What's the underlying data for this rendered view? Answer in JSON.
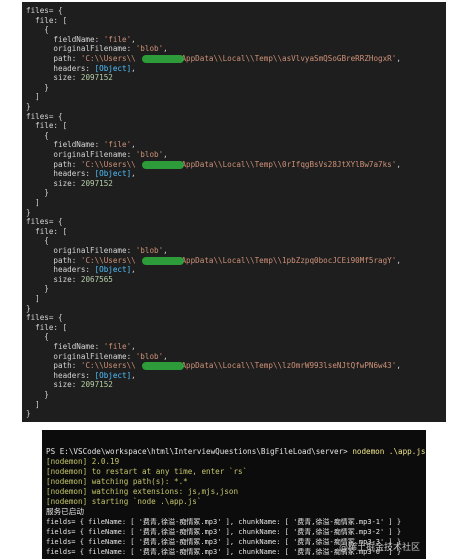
{
  "top_terminal": {
    "lines": [
      {
        "t": "files= {",
        "c": "key"
      },
      {
        "t": "  file: [",
        "c": "key"
      },
      {
        "t": "    {",
        "c": "key"
      },
      {
        "t": "      fieldName: ",
        "c": "key",
        "v": "'file'",
        "vc": "str",
        "s": ","
      },
      {
        "t": "      originalFilename: ",
        "c": "key",
        "v": "'blob'",
        "vc": "str",
        "s": ","
      },
      {
        "t": "      path: ",
        "c": "key",
        "v": "'C:\\\\Users\\\\          AppData\\\\Local\\\\Temp\\\\asVlvyaSmQSoGBreRRZHogxR'",
        "vc": "str",
        "s": ","
      },
      {
        "t": "      headers: ",
        "c": "key",
        "v": "[Object]",
        "vc": "obj",
        "s": ","
      },
      {
        "t": "      size: ",
        "c": "key",
        "v": "2097152",
        "vc": "num",
        "s": ""
      },
      {
        "t": "    }",
        "c": "key"
      },
      {
        "t": "  ]",
        "c": "key"
      },
      {
        "t": "}",
        "c": "key"
      },
      {
        "t": "files= {",
        "c": "key"
      },
      {
        "t": "  file: [",
        "c": "key"
      },
      {
        "t": "    {",
        "c": "key"
      },
      {
        "t": "      fieldName: ",
        "c": "key",
        "v": "'file'",
        "vc": "str",
        "s": ","
      },
      {
        "t": "      originalFilename: ",
        "c": "key",
        "v": "'blob'",
        "vc": "str",
        "s": ","
      },
      {
        "t": "      path: ",
        "c": "key",
        "v": "'C:\\\\Users\\\\          AppData\\\\Local\\\\Temp\\\\0rIfqgBsVs28JtXYlBw7a7ks'",
        "vc": "str",
        "s": ","
      },
      {
        "t": "      headers: ",
        "c": "key",
        "v": "[Object]",
        "vc": "obj",
        "s": ","
      },
      {
        "t": "      size: ",
        "c": "key",
        "v": "2097152",
        "vc": "num",
        "s": ""
      },
      {
        "t": "    }",
        "c": "key"
      },
      {
        "t": "  ]",
        "c": "key"
      },
      {
        "t": "}",
        "c": "key"
      },
      {
        "t": "files= {",
        "c": "key"
      },
      {
        "t": "  file: [",
        "c": "key"
      },
      {
        "t": "    {",
        "c": "key"
      },
      {
        "t": "      originalFilename: ",
        "c": "key",
        "v": "'blob'",
        "vc": "str",
        "s": ","
      },
      {
        "t": "      path: ",
        "c": "key",
        "v": "'C:\\\\Users\\\\          AppData\\\\Local\\\\Temp\\\\1pbZzpq0bocJCEi90Mf5ragY'",
        "vc": "str",
        "s": ","
      },
      {
        "t": "      headers: ",
        "c": "key",
        "v": "[Object]",
        "vc": "obj",
        "s": ","
      },
      {
        "t": "      size: ",
        "c": "key",
        "v": "2067565",
        "vc": "num",
        "s": ""
      },
      {
        "t": "    }",
        "c": "key"
      },
      {
        "t": "  ]",
        "c": "key"
      },
      {
        "t": "}",
        "c": "key"
      },
      {
        "t": "files= {",
        "c": "key"
      },
      {
        "t": "  file: [",
        "c": "key"
      },
      {
        "t": "    {",
        "c": "key"
      },
      {
        "t": "      fieldName: ",
        "c": "key",
        "v": "'file'",
        "vc": "str",
        "s": ","
      },
      {
        "t": "      originalFilename: ",
        "c": "key",
        "v": "'blob'",
        "vc": "str",
        "s": ","
      },
      {
        "t": "      path: ",
        "c": "key",
        "v": "'C:\\\\Users\\\\          AppData\\\\Local\\\\Temp\\\\lzOmrW993lseNJtQfwPN6w43'",
        "vc": "str",
        "s": ","
      },
      {
        "t": "      headers: ",
        "c": "key",
        "v": "[Object]",
        "vc": "obj",
        "s": ","
      },
      {
        "t": "      size: ",
        "c": "key",
        "v": "2097152",
        "vc": "num",
        "s": ""
      },
      {
        "t": "    }",
        "c": "key"
      },
      {
        "t": "  ]",
        "c": "key"
      },
      {
        "t": "}",
        "c": "key"
      }
    ]
  },
  "bottom_terminal": {
    "prompt": "PS E:\\VSCode\\workspace\\html\\InterviewQuestions\\BigFileLoad\\server>",
    "command": " nodemon .\\app.js",
    "nodemon_lines": [
      "[nodemon] 2.0.19",
      "[nodemon] to restart at any time, enter `rs`",
      "[nodemon] watching path(s): *.*",
      "[nodemon] watching extensions: js,mjs,json",
      "[nodemon] starting `node .\\app.js`"
    ],
    "service_started": "服务已启动",
    "fields_lines": [
      "fields= { fileName: [ '费青,徐溢-痴情冢.mp3' ], chunkName: [ '费青,徐溢-痴情冢.mp3-1' ] }",
      "fields= { fileName: [ '费青,徐溢-痴情冢.mp3' ], chunkName: [ '费青,徐溢-痴情冢.mp3-2' ] }",
      "fields= { fileName: [ '费青,徐溢-痴情冢.mp3' ], chunkName: [ '费青,徐溢-痴情冢.mp3-3' ] }",
      "fields= { fileName: [ '费青,徐溢-痴情冢.mp3' ], chunkName: [ '费青,徐溢-痴情冢.mp3-0' ] }"
    ]
  },
  "watermark": "@稀土掘金技术社区",
  "colors": {
    "redaction": "#2fa83c",
    "string": "#ce9178",
    "number": "#b5cea8",
    "object": "#4fc1ff"
  }
}
